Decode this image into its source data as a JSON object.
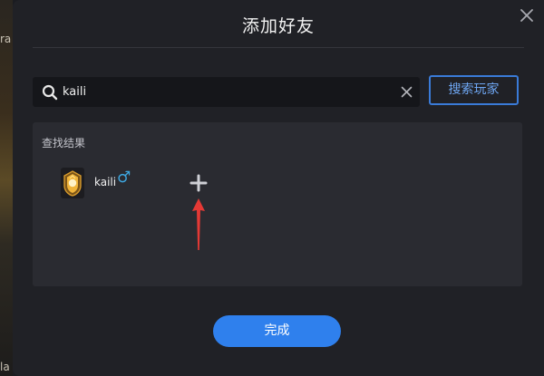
{
  "dialog": {
    "title": "添加好友",
    "search": {
      "value": "kaili",
      "button_label": "搜索玩家"
    },
    "results": {
      "heading": "查找结果",
      "players": [
        {
          "name": "kaili",
          "gender_symbol": "♂",
          "avatar_icon": "game-badge-icon"
        }
      ]
    },
    "done_label": "完成"
  },
  "background": {
    "fragment_top": "ra",
    "fragment_bottom": "la"
  },
  "colors": {
    "dialog_bg": "#202126",
    "panel_bg": "#2a2b31",
    "accent_blue": "#2f80ed",
    "gender_blue": "#3ea7e0",
    "arrow_red": "#e53935"
  }
}
